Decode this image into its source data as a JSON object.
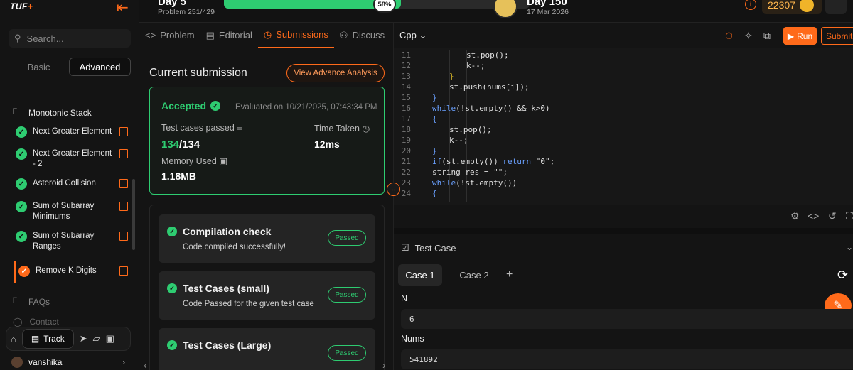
{
  "brand": {
    "logo": "TUF",
    "logo_mark": "+"
  },
  "sidebar": {
    "search_placeholder": "Search...",
    "modes": [
      "Basic",
      "Advanced"
    ],
    "active_mode": "Advanced",
    "folder": "Monotonic Stack",
    "problems": [
      {
        "label": "Next Greater Element",
        "status": "solved"
      },
      {
        "label": "Next Greater Element - 2",
        "status": "solved"
      },
      {
        "label": "Asteroid Collision",
        "status": "solved"
      },
      {
        "label": "Sum of Subarray Minimums",
        "status": "solved"
      },
      {
        "label": "Sum of Subarray Ranges",
        "status": "solved"
      },
      {
        "label": "Remove K Digits",
        "status": "current"
      }
    ],
    "faqs": "FAQs",
    "contact": "Contact",
    "dock_track": "Track",
    "username": "vanshika"
  },
  "topbar": {
    "day_left": "Day 5",
    "problem_count": "Problem 251/429",
    "progress_percent": 58,
    "progress_label": "58%",
    "day_right": "Day 150",
    "target_date": "17 Mar 2026",
    "coins": "22307",
    "accent": "#ff6a1a",
    "progress_color": "#2ecc71"
  },
  "tabs": [
    {
      "label": "Problem",
      "icon": "code-icon"
    },
    {
      "label": "Editorial",
      "icon": "document-icon"
    },
    {
      "label": "Submissions",
      "icon": "clock-icon",
      "active": true
    },
    {
      "label": "Discuss",
      "icon": "people-icon"
    }
  ],
  "submission": {
    "heading": "Current submission",
    "advance_button": "View Advance Analysis",
    "status": "Accepted",
    "evaluated": "Evaluated on 10/21/2025, 07:43:34 PM",
    "test_cases_label": "Test cases passed",
    "passed_count": "134",
    "total_count": "/134",
    "time_label": "Time Taken",
    "time_value": "12ms",
    "memory_label": "Memory Used",
    "memory_value": "1.18MB",
    "checks": [
      {
        "title": "Compilation check",
        "desc": "Code compiled successfully!",
        "badge": "Passed"
      },
      {
        "title": "Test Cases (small)",
        "desc": "Code Passed for the given test case",
        "badge": "Passed"
      },
      {
        "title": "Test Cases (Large)",
        "desc": "",
        "badge": "Passed"
      }
    ]
  },
  "editor": {
    "language": "Cpp",
    "run_label": "Run",
    "submit_label": "Submit",
    "lines": [
      {
        "n": "11",
        "indent": 4,
        "parts": [
          [
            "fn",
            "st.pop();"
          ]
        ]
      },
      {
        "n": "12",
        "indent": 4,
        "parts": [
          [
            "fn",
            "k--;"
          ]
        ]
      },
      {
        "n": "13",
        "indent": 3,
        "parts": [
          [
            "brace",
            "}"
          ]
        ]
      },
      {
        "n": "14",
        "indent": 3,
        "parts": [
          [
            "fn",
            "st.push(nums[i]);"
          ]
        ]
      },
      {
        "n": "15",
        "indent": 2,
        "parts": [
          [
            "kw",
            "}"
          ]
        ]
      },
      {
        "n": "16",
        "indent": 2,
        "parts": [
          [
            "kw",
            "while"
          ],
          [
            "fn",
            "(!st.empty() && k>0)"
          ]
        ]
      },
      {
        "n": "17",
        "indent": 2,
        "parts": [
          [
            "kw",
            "{"
          ]
        ]
      },
      {
        "n": "18",
        "indent": 3,
        "parts": [
          [
            "fn",
            "st.pop();"
          ]
        ]
      },
      {
        "n": "19",
        "indent": 3,
        "parts": [
          [
            "fn",
            "k--;"
          ]
        ]
      },
      {
        "n": "20",
        "indent": 2,
        "parts": [
          [
            "kw",
            "}"
          ]
        ]
      },
      {
        "n": "21",
        "indent": 2,
        "parts": [
          [
            "kw",
            "if"
          ],
          [
            "fn",
            "(st.empty()) "
          ],
          [
            "kw",
            "return"
          ],
          [
            "fn",
            " \"0\";"
          ]
        ]
      },
      {
        "n": "22",
        "indent": 2,
        "parts": [
          [
            "fn",
            "string res = \"\";"
          ]
        ]
      },
      {
        "n": "23",
        "indent": 2,
        "parts": [
          [
            "kw",
            "while"
          ],
          [
            "fn",
            "(!st.empty())"
          ]
        ]
      },
      {
        "n": "24",
        "indent": 2,
        "parts": [
          [
            "kw",
            "{"
          ]
        ]
      }
    ]
  },
  "testcase": {
    "heading": "Test Case",
    "cases": [
      "Case 1",
      "Case 2"
    ],
    "active_case": "Case 1",
    "params": [
      {
        "name": "N",
        "value": "6"
      },
      {
        "name": "Nums",
        "value": "541892"
      }
    ]
  }
}
